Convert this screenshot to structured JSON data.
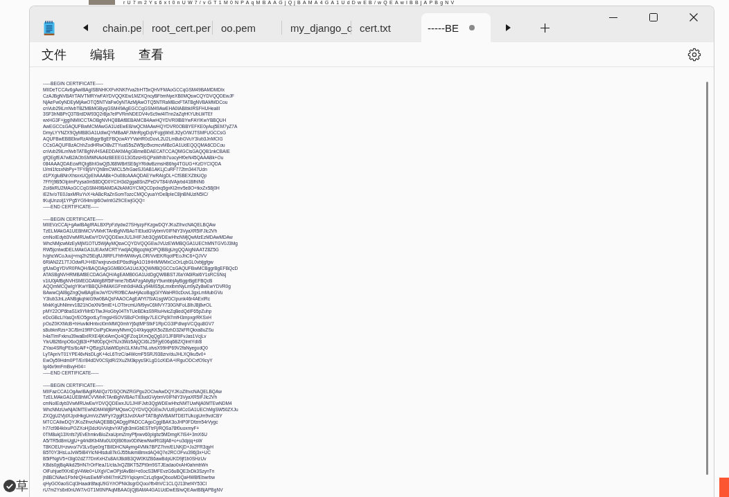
{
  "background": {
    "top_text": "rU7m2Ys6xt0nUW7/vGT1M0NPAqMBAAGjQjBAMA4GA1UdDwEB/wQEAwIBBjAPBgNV",
    "corner_text": "草"
  },
  "window": {
    "tabs": [
      {
        "label": "chain.pe",
        "selected": false,
        "modified": false
      },
      {
        "label": "root_cert.per",
        "selected": false,
        "modified": false
      },
      {
        "label": "oo.pem",
        "selected": false,
        "modified": false
      },
      {
        "label": "my_django_c",
        "selected": false,
        "modified": false
      },
      {
        "label": "cert.txt",
        "selected": false,
        "modified": false
      },
      {
        "label": "-----BE",
        "selected": true,
        "modified": true
      }
    ],
    "menu": [
      "文件",
      "编辑",
      "查看"
    ],
    "editor": {
      "certificates": [
        {
          "begin": "-----BEGIN CERTIFICATE-----",
          "lines": [
            "MIIDeTCCAv6gAwIBAgISBNHKXFvKNKfYva2bHT5xQHVFMAoGCCqGSM49BAMDMDIx",
            "CzAJBgNVBAYTAlVTMRYwFAYDVQQKEw1MZXQncyBFbmNyeXB0MQswCQYDVQQDEwJF",
            "NjAeFw0yNDEyMjAwOTQ5NTVaFw0yNTAzMjAwOTQ5NTRaMBcxFTATBgNVBAMMDCou",
            "cnVub29iLmNvbTBZMBMGByqGSM49AgEGCCqGSM49AwEHA0IABIbkIRSFHUHeaiII",
            "3SF3hNBPrQ3TBrdDW93Q2r8ja7elPVRmNDEDV4vSc9wi4lTnn2aZqfrKYUbLWTEf",
            "wxHG3F+jggINMIICCTAOBgNVHQ8BAf8EBAMCB4AwHQYDVR0lBBYwFAYIKwYBBQUH",
            "AwEGCCsGAQUFBwMCMAwGA1UdEwEB/wQCMAAwHQYDVR0OBBYEFKE0yAuj5EM7yZ7A",
            "DmyLYYNZX9QyMB8GA1UdIwQYMBaAFJMnRpgDqVFojpjWxEJI2yO/WJTSMFUGCCsG",
            "AQUFBwEBBEkwRzAhBggrBgEFBQcwAYYVaHR0cDovL2U2Lm8ubGVuY3Iub3JnMCIG",
            "CCsGAQUFBzAChhZodHRwOi8vZTYuaS5sZW5jci5vcmcvMBcGA1UdEQQQMA6CDCou",
            "cnVub29iLmNvbTATBgNVHSAEDDAKMAgGBmeBDAECATCCAQMGCisGAQQB1nkCBAIE",
            "gfQEgfEA7wB2AObSMWNAd4zBEEEG13G5zsHSQPaWhIb7uocyHf0eN45QAAABk+Ou",
            "084AAAQDAEcwRQIgBhIGwQj5J68WBrtSE6gYRidwBzmsH86hg4TGUG+KzDYCIQDA",
            "lJ/ml1fcsxNbPy+TFY8j9/YQh8mCWiCL5/hGaeSJ0AB1AKLjCuRF772tm3447Udn",
            "d1PXgluBNnXhsxxUQpEhAAABk+Ou08cAAAQDAEYwRAIgDL+CfSBEXZibUQp",
            "7FfYj9B5OIpimPzysa0m58DQD0YCIH3d2gga8SnZPeDVT84/dVAjvbd41BfhIN6",
            "ZoI6kRU2MAoGCCqGSM49BAMDA2kAMGYCMQCDpdxq5gxKl2mv5e8O+tkxZx58j0H",
            "iE2Iv/oTE0JaxMRuYvX+kABcRaZnSomTozcCMQCyuaYrDe8pIeC8jnBNUziN5IC/",
            "tKujUnzolj1YPg5YG94m/gi6OwIntGZ9CEwjGQQ="
          ],
          "end": "-----END CERTIFICATE-----"
        },
        {
          "begin": "-----BEGIN CERTIFICATE-----",
          "lines": [
            "MIIEVzCCAj+gAwIBAgIRALBXPpFzlydw27SHyzpFKzgwDQYJKoZIhvcNAQELBQAw",
            "TzELMAkGA1UEBhMCVVMxKTAnBgNVBAoTIEludGVybmV0IFNlY3VyaXR5IFJlc2Vh",
            "cmNoIEdyb3VwMRUwEwYDVQQDEwxJU1JHIFJvb3QgWDEwHhcNMjQwMzEzMDAwMDAw",
            "WhcNMjcwMzEyMjM1OTU5WjAyMQswCQYDVQQGEwJVUzEWMBQGA1UEChMNTGV0J3Mg",
            "RW5jcnlwdDELMAkGA1UEAxMCRTYwdjAQBgcqhkjOPQIBBgUrgQQAIgNiAATZ8Z5G",
            "h/ghcWCoJuuj+rnq2h25EqfUJtlRFLFhfHWWvyILOR/VvtEKRqotPEoJhC6+QJVV",
            "6RlAN2Z17TJOdwRJ+HB7wxjnzvdxEP6sdNgA1O1tHHMWMxCcOrLqbGL0vbijgfgw",
            "gfUwDgYDVR0PAQH/BAQDAgGGMB0GA1UdJQQWMBQGCCsGAQUFBwMCBggrBgEFBQcD",
            "ATASBgNVHRMBAf8ECDAGAQH/AgEAMB0GA1UdDgQWBBSTJ0aYA6lRaI6Y1sRCSNsj",
            "v1iU0jAfBgNVHSMEGDAWgBR5tFnme7bl5AFzgAiIyBpY9umbbjAyBggrBgEFBQcB",
            "AQQmMCQwIgYIKwYBBQUHMAKGFmh0dHA6Ly94MS5pLmxlbmNyLm9yZy8wEwYDVR0g",
            "BAwwCjAIBgZngQwBAgEwJwYDVR0fBCAwHjAcoBqgGIYWaHR0cDovL3gxLmMubGVu",
            "Y3Iub3JnLzANBgkqhkiG9w0BAQsFAAOCAgEAfYt7SiA1sgWGCIpunk46r4AExIRc",
            "MxkKgUhNlmrv1B21hOaXN/5miE+LOTbrcmU/M9yvC6MVY730GNFoL8IhJ8j8vrOL",
            "pMY22OP6baS1k9YMrtDTlwJHoGby04ThTUeBDksS9RiuHvicZqBedQdIF65pZuhp",
            "eDcGBcLiYasQr/EO5gxxtLyTmgsHSOVSBcFOn9lgv7LECPq9i7mfH3mpxgrRKSxH",
            "pOoZ0KXMcB+hHuvlklHntvcI0mMMQ0mhYj6qtMFStkF1RpCG3IPdIwpVCQqu8GV7",
            "s8ubknRzs+3C/Bm19RFOoiPpDkwvyNfvmQ14XkyqqKK5oZ8zhD32kFRQkxa8uZSu",
            "h4aTImFxknu39waBxIRXE4jKxlAmQc4QjFZoq1KmQqQg0J/1JF8RlFvJas1VcjLv",
            "YlvUB2t6npO6oQjB3l+PNf0DpQH7iUx3Wz5AjQCi6L25FjyE06q6BZ/QlmtYdl/8",
            "ZYao4SRqPEs/6cAiF+Qf5zg2UlaWtDphl1LKMuTNLotvsX99HP69V2faNyegodQ0",
            "LyTApr/vT01YPE46vNsDLgK+4cL6TrzC/a4WcmF5SRJ938zrv/duJHLXQIku5v0+",
            "EwOy59Hdm0PT/Er/84dDV0CSjdR/2XuZM3kpysSKLgD1cKiDA+IRguODCxfO9cyY",
            "Ig46v9mFmBvyH04="
          ],
          "end": "-----END CERTIFICATE-----"
        },
        {
          "begin": "-----BEGIN CERTIFICATE-----",
          "lines": [
            "MIIFazCCA1OgAwIBAgIRAIIQz7DSQONZRGPgu2OCiwAwDQYJKoZIhvcNAQELBQAw",
            "TzELMAkGA1UEBhMCVVMxKTAnBgNVBAoTIEludGVybmV0IFNlY3VyaXR5IFJlc2Vh",
            "cmNoIEdyb3VwMRUwEwYDVQQDEwxJU1JHIFJvb3QgWDEwHhcNMTUwNjA0MTEwNDM4",
            "WhcNMzUwNjA0MTEwNDM4WjBPMQswCQYDVQQGEwJVUzEpMCcGA1UEChMgSW50ZXJu",
            "ZXQgU2VjdXJpdHkgUmVzZWFyY2ggR3JvdXAxFTATBgNVBAMTDElTUkcgUm9vdCBY",
            "MTCCAiIwDQYJKoZIhvcNAQEBBQADggIPADCCAgoCggIBAK3oJHP0FDfzm54rVygc",
            "h77ct984kIxuPOZXoHj3dcKi/vVqbvYATyjb3miGbESTtrFj/RQSa78f0uoxmyF+",
            "0TM8ukj13Xnfs7j/EvEhmkvBioZxaUpmZmyPfjxwv60pIgbz5MDmgK7iS4+3mX6U",
            "A5/TR5d8mUgjU+g4rk8Kb4Mu0UlXjIB0ttov0DiNewNwIRt18jA8+o+u3dpjq+sW",
            "T8KOEUt+zwvo/7V3LvSye0rgTBIlDHCNAymg4VMk7BPZ7hm/ELNKjD+Jo2FR3qyH",
            "B5T0Y3HsLuJvW5iB4YlcNHlsdu87kGJ55tukmi8mxdAQ4Q7e2RCOFvu396j3x+UC",
            "B5iPNgiV5+I3lg02dZ77DnKxHZu8A/lJBdiB3QW0KtZB6awBdpUKD9jf1b0SHzUv",
            "KBds0pjBqAlkd25HN7rOrFleaJ1/ctaJxQZBKT5ZPt0m9STJEadao0xAH0ahmbWn",
            "OlFuhjuefXKnEgV4We0+UXgVCwOPjdAvBbI+e0ocS3MFEvzG6uBQE3xDk3SzynTn",
            "jh8BCNAw1FtxNrQHusEwMFxIt4I7mKZ9YIqioymCzLq9gwQbooMDQaHWBfEbwrbw",
            "qHyGO0aoSCqI3Haadr8faqU9GY/rOPNk3sgrDQoo//fb4hVC1CLQJ13hef4Y53CI",
            "rU7m2Ys6xt0nUW7/vGT1M0NPAqMBAAGjQjBAMA4GA1UdDwEB/wQEAwIBBjAPBgNV"
          ]
        }
      ]
    }
  }
}
